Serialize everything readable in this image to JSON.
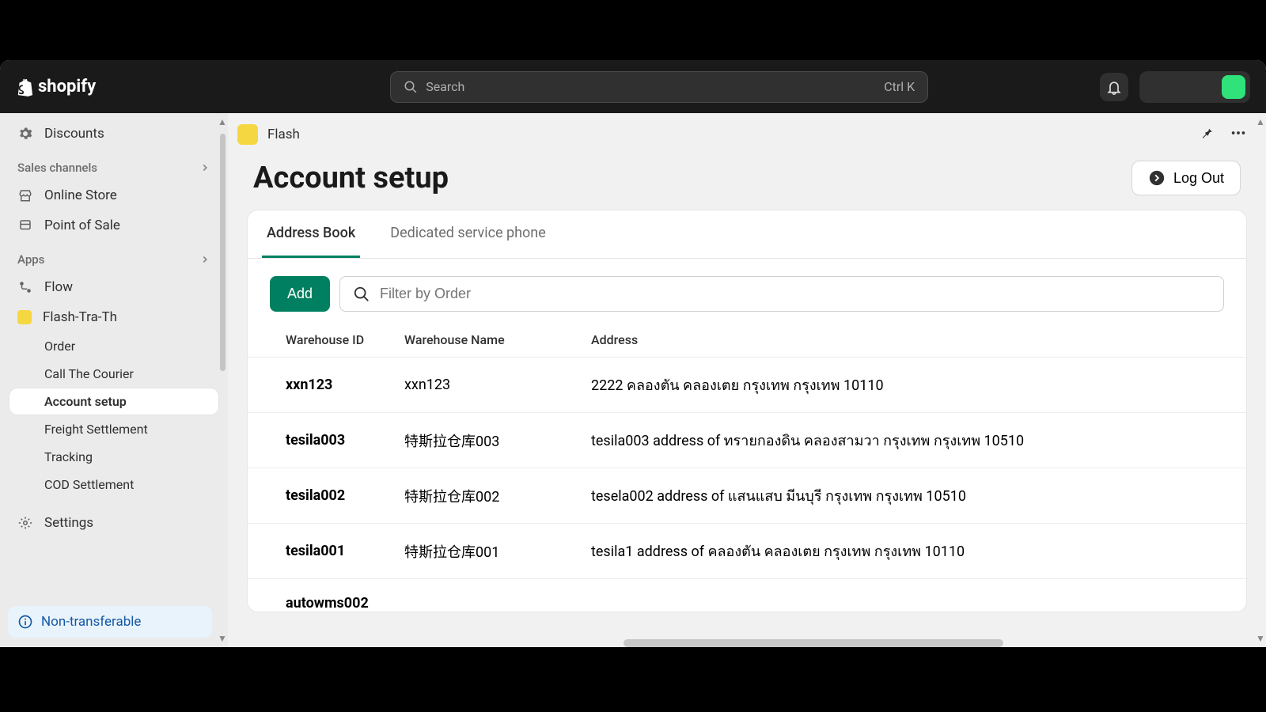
{
  "brand": "shopify",
  "search": {
    "placeholder": "Search",
    "shortcut": "Ctrl K"
  },
  "sidebar": {
    "discounts": "Discounts",
    "sales_channels_label": "Sales channels",
    "online_store": "Online Store",
    "point_of_sale": "Point of Sale",
    "apps_label": "Apps",
    "flow": "Flow",
    "flash_app": "Flash-Tra-Th",
    "subitems": [
      "Order",
      "Call The Courier",
      "Account setup",
      "Freight Settlement",
      "Tracking",
      "COD Settlement"
    ],
    "settings": "Settings",
    "non_transferable": "Non-transferable"
  },
  "app_header": {
    "name": "Flash"
  },
  "page": {
    "title": "Account setup",
    "logout": "Log Out",
    "tabs": [
      "Address Book",
      "Dedicated service phone"
    ],
    "add_label": "Add",
    "filter_placeholder": "Filter by Order",
    "columns": [
      "Warehouse ID",
      "Warehouse Name",
      "Address"
    ],
    "rows": [
      {
        "id": "xxn123",
        "name": "xxn123",
        "address": "2222 คลองตัน คลองเตย กรุงเทพ กรุงเทพ 10110"
      },
      {
        "id": "tesila003",
        "name": "特斯拉仓库003",
        "address": "tesila003 address of ทรายกองดิน คลองสามวา กรุงเทพ กรุงเทพ 10510"
      },
      {
        "id": "tesila002",
        "name": "特斯拉仓库002",
        "address": "tesela002 address of แสนแสบ มีนบุรี กรุงเทพ กรุงเทพ 10510"
      },
      {
        "id": "tesila001",
        "name": "特斯拉仓库001",
        "address": "tesila1 address of คลองตัน คลองเตย กรุงเทพ กรุงเทพ 10110"
      },
      {
        "id": "autowms002",
        "name": "",
        "address": ""
      }
    ]
  }
}
